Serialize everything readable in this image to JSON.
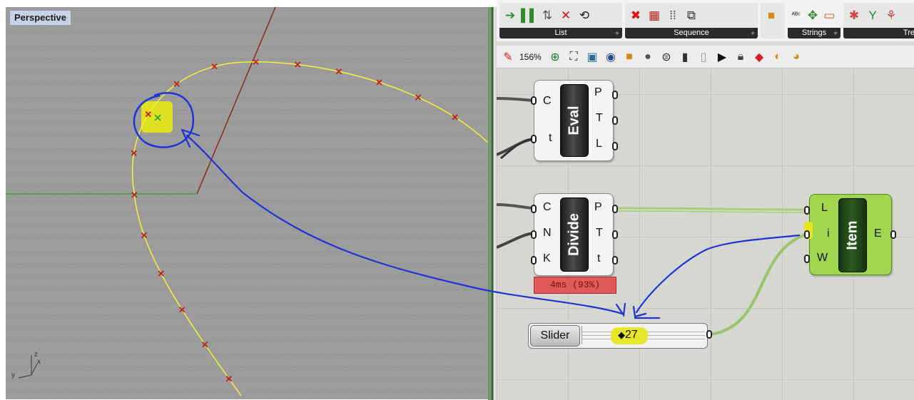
{
  "viewport": {
    "label": "Perspective",
    "axes": {
      "x": "x",
      "y": "y",
      "z": "z"
    }
  },
  "ribbon": {
    "groups": [
      {
        "title": "List",
        "icons": [
          "list-item-icon",
          "list-split-icon",
          "sort-list-icon",
          "cull-x-icon",
          "shift-list-icon"
        ]
      },
      {
        "title": "Sequence",
        "icons": [
          "cull-pattern-icon",
          "grid-icon",
          "series-icon",
          "range-icon"
        ]
      },
      {
        "title": "",
        "icons": [
          "box-icon"
        ]
      },
      {
        "title": "Strings",
        "icons": [
          "text-icon",
          "format-icon",
          "concat-icon"
        ]
      },
      {
        "title": "Tre",
        "icons": [
          "tree-icon",
          "branch-icon",
          "graft-icon"
        ]
      }
    ]
  },
  "toolbar": {
    "zoom": "156%"
  },
  "components": {
    "eval": {
      "name": "Eval",
      "inputs": [
        "C",
        "t"
      ],
      "outputs": [
        "P",
        "T",
        "L"
      ]
    },
    "divide": {
      "name": "Divide",
      "inputs": [
        "C",
        "N",
        "K"
      ],
      "outputs": [
        "P",
        "T",
        "t"
      ],
      "timer": "4ms (93%)"
    },
    "item": {
      "name": "Item",
      "inputs": [
        "L",
        "i",
        "W"
      ],
      "outputs": [
        "E"
      ]
    },
    "slider": {
      "label": "Slider",
      "value": "27",
      "marker": "◆"
    }
  },
  "colors": {
    "viewport_bg": "#9c9c9c",
    "curve": "#f2f23a",
    "annotation": "#1f33d6",
    "highlight": "#e6e619",
    "item_component": "#9fd64d",
    "timer_bg": "#e05a5a"
  }
}
